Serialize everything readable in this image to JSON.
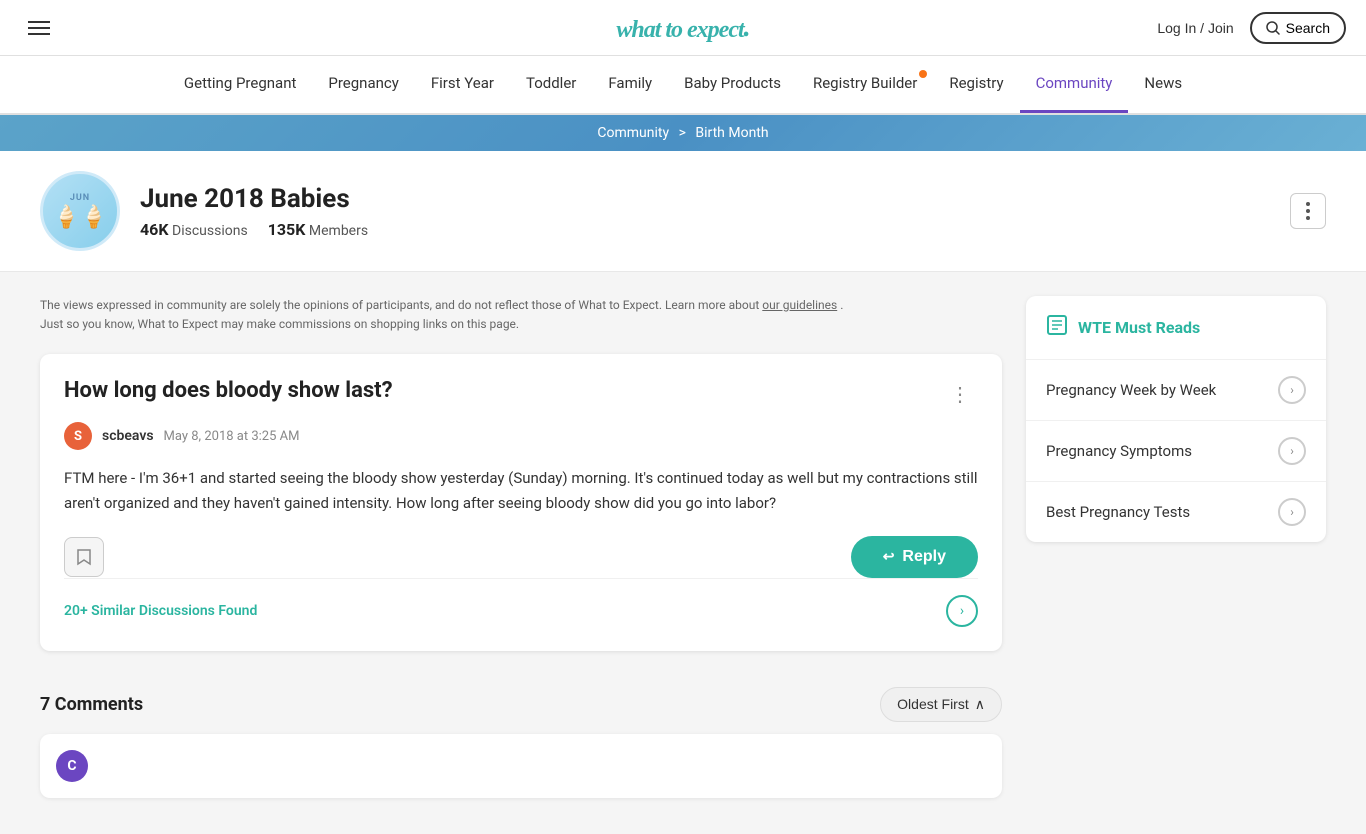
{
  "header": {
    "login_label": "Log In / Join",
    "search_label": "Search",
    "logo_text": "what to expect",
    "logo_dot": "."
  },
  "nav": {
    "items": [
      {
        "label": "Getting Pregnant",
        "active": false,
        "badge": false
      },
      {
        "label": "Pregnancy",
        "active": false,
        "badge": false
      },
      {
        "label": "First Year",
        "active": false,
        "badge": false
      },
      {
        "label": "Toddler",
        "active": false,
        "badge": false
      },
      {
        "label": "Family",
        "active": false,
        "badge": false
      },
      {
        "label": "Baby Products",
        "active": false,
        "badge": false
      },
      {
        "label": "Registry Builder",
        "active": false,
        "badge": true
      },
      {
        "label": "Registry",
        "active": false,
        "badge": false
      },
      {
        "label": "Community",
        "active": true,
        "badge": false
      },
      {
        "label": "News",
        "active": false,
        "badge": false
      }
    ]
  },
  "breadcrumb": {
    "community": "Community",
    "separator": ">",
    "current": "Birth Month"
  },
  "group": {
    "month": "JUN",
    "title": "June 2018 Babies",
    "discussions_count": "46K",
    "discussions_label": "Discussions",
    "members_count": "135K",
    "members_label": "Members",
    "emoji": "🍦🍦"
  },
  "disclaimer": {
    "text1": "The views expressed in community are solely the opinions of participants, and do not reflect those of What to Expect. Learn more about ",
    "link_text": "our guidelines",
    "text2": ".",
    "text3": "Just so you know, What to Expect may make commissions on shopping links on this page."
  },
  "post": {
    "title": "How long does bloody show last?",
    "author": "scbeavs",
    "author_initial": "S",
    "date": "May 8, 2018 at 3:25 AM",
    "body": "FTM here - I'm 36+1 and started seeing the bloody show yesterday (Sunday) morning. It's continued today as well but my contractions still aren't organized and they haven't gained intensity. How long after seeing bloody show did you go into labor?",
    "reply_label": "Reply",
    "similar_label": "20+ Similar Discussions Found"
  },
  "comments": {
    "count_label": "7 Comments",
    "sort_label": "Oldest First"
  },
  "sidebar": {
    "title": "WTE Must Reads",
    "items": [
      {
        "label": "Pregnancy Week by Week"
      },
      {
        "label": "Pregnancy Symptoms"
      },
      {
        "label": "Best Pregnancy Tests"
      }
    ]
  }
}
